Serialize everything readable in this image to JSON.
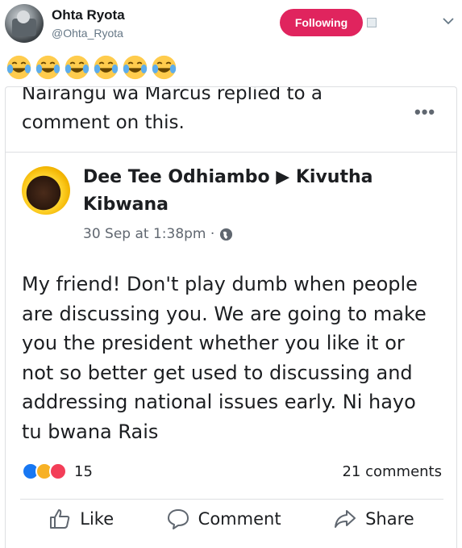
{
  "tweet": {
    "user_name": "Ohta Ryota",
    "handle": "@Ohta_Ryota",
    "follow_label": "Following",
    "emojis": [
      "😂",
      "😂",
      "😂",
      "😂",
      "😂",
      "😂"
    ]
  },
  "fb_post": {
    "notice": "Nairangu wa Marcus replied to a comment on this.",
    "more_label": "•••",
    "poster": "Dee Tee Odhiambo ▶ Kivutha Kibwana",
    "time": "30 Sep at 1:38pm ·",
    "text": "My friend! Don't play dumb when people are discussing you. We are going to make you the president whether you like it or not so better get used to discussing and addressing national issues early. Ni hayo tu bwana Rais",
    "reaction_count": "15",
    "comments": "21 comments",
    "actions": {
      "like": "Like",
      "comment": "Comment",
      "share": "Share"
    }
  },
  "colors": {
    "follow": "#e0245e",
    "like": "#1877f2",
    "haha": "#f7b125",
    "love": "#f33e58"
  }
}
